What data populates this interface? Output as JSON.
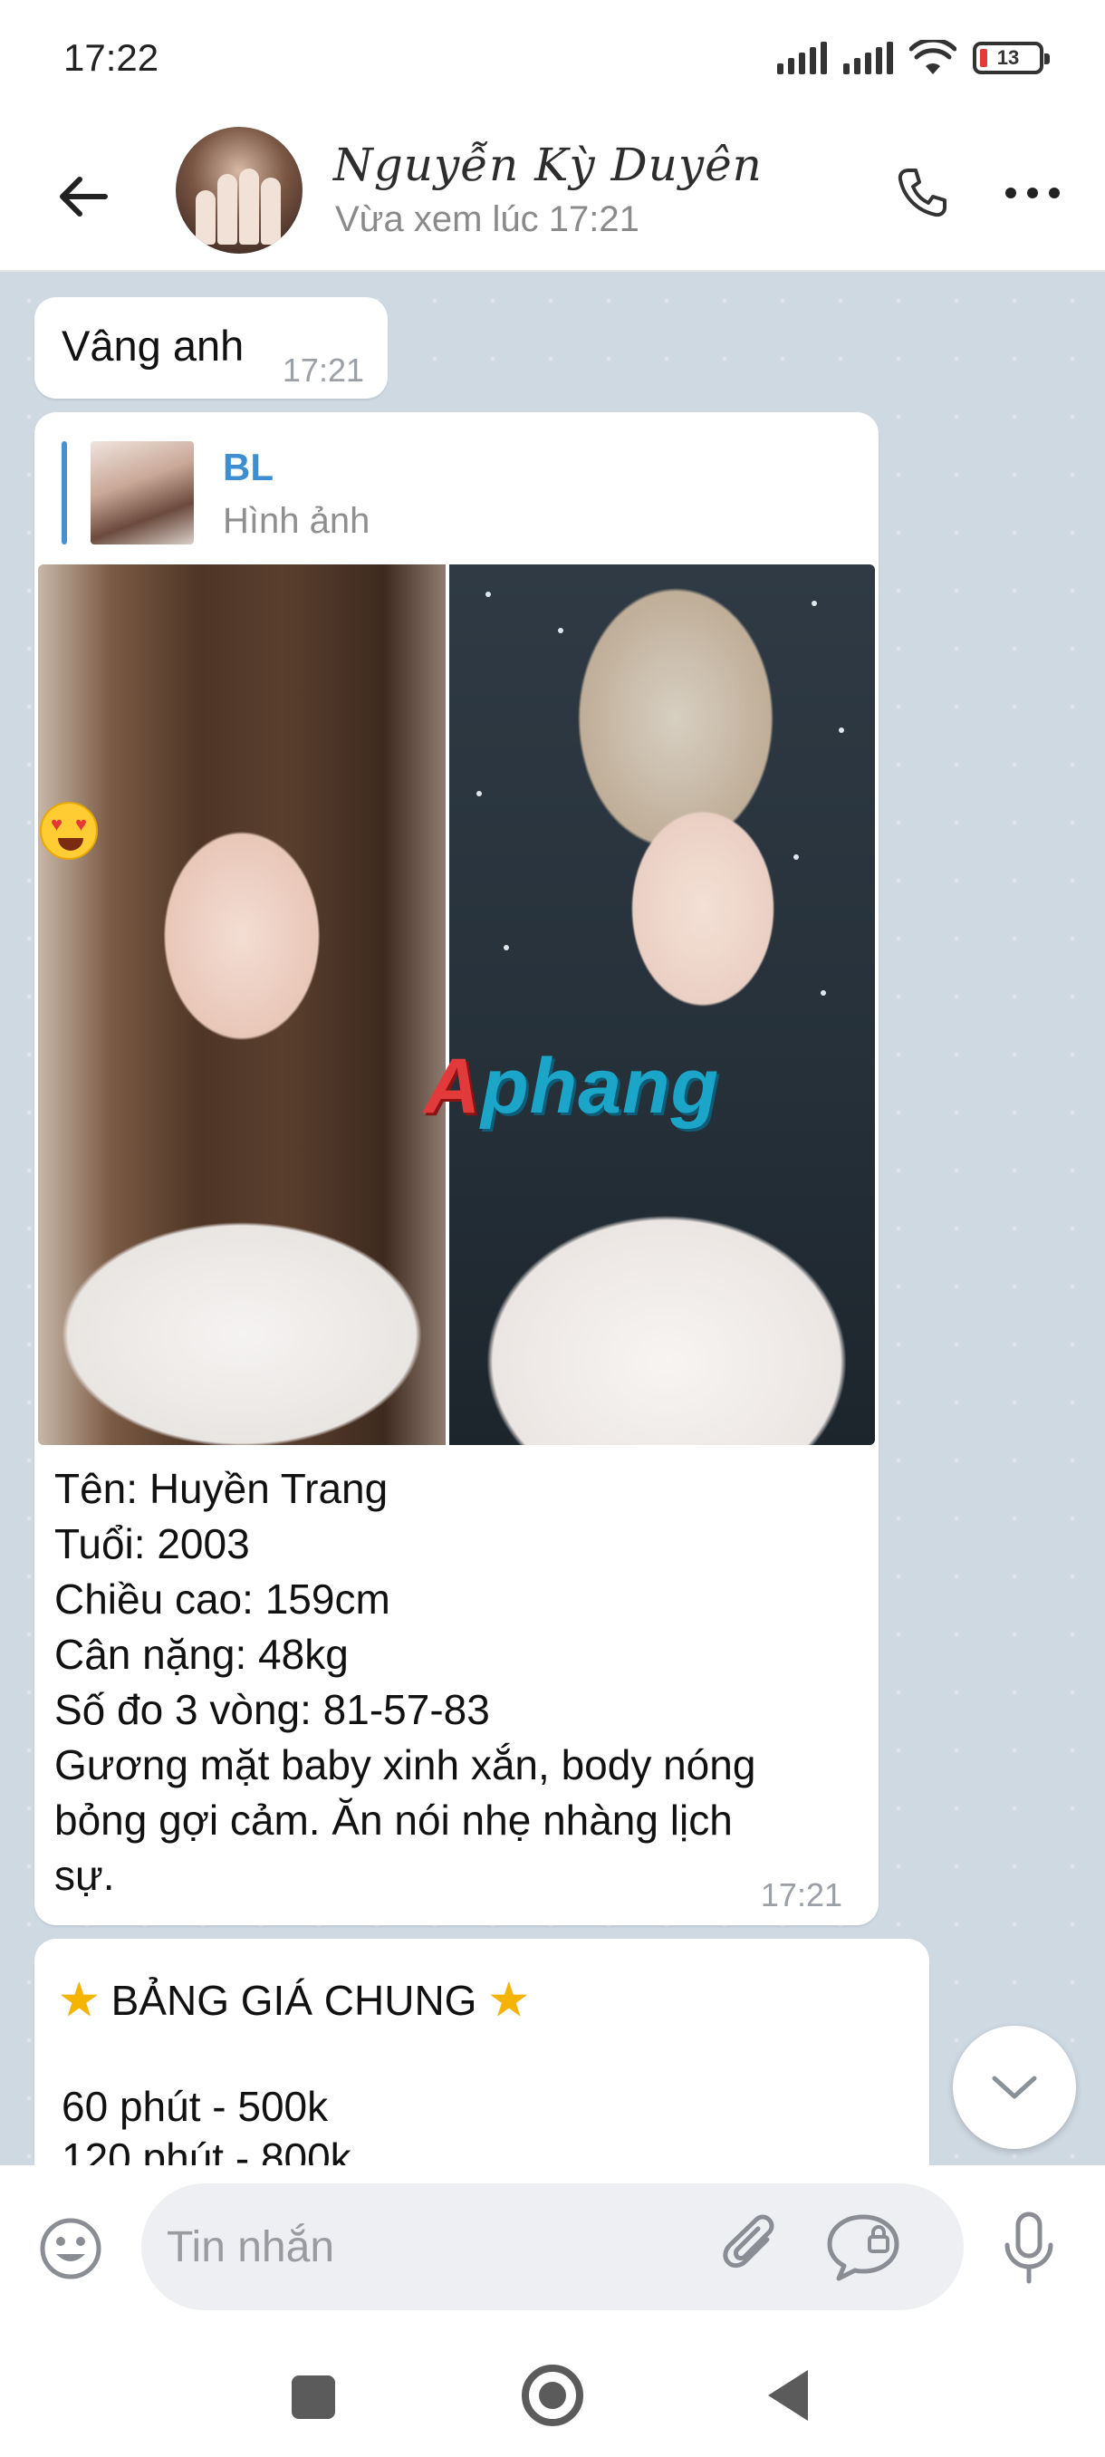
{
  "status_bar": {
    "time": "17:22",
    "battery_level": "13",
    "icons": [
      "signal-icon",
      "signal-icon",
      "wifi-icon",
      "battery-icon"
    ]
  },
  "header": {
    "contact_name": "Nguyễn Kỳ Duyên",
    "last_seen": "Vừa xem lúc 17:21",
    "icons": [
      "back-arrow-icon",
      "phone-icon",
      "more-icon"
    ]
  },
  "messages": [
    {
      "text": "Vâng anh",
      "time": "17:21"
    },
    {
      "reply": {
        "sender": "BL",
        "type": "Hình ảnh"
      },
      "watermark": "Aphang",
      "lines": [
        "Tên: Huyền Trang",
        "Tuổi: 2003",
        "Chiều cao: 159cm",
        "Cân nặng: 48kg",
        "Số đo 3 vòng: 81-57-83",
        "Gương mặt baby xinh xắn, body nóng",
        "bỏng gợi cảm. Ăn nói nhẹ nhàng lịch",
        "sự."
      ],
      "time": "17:21"
    },
    {
      "title": "BẢNG GIÁ CHUNG",
      "lines": [
        "60 phút - 500k",
        "120 phút - 800k"
      ]
    }
  ],
  "input": {
    "placeholder": "Tin nhắn",
    "icons": [
      "emoji-icon",
      "attach-icon",
      "secret-chat-icon",
      "mic-icon"
    ]
  },
  "colors": {
    "accent": "#3d8fd1",
    "chat_background": "#cfd9e2",
    "time_text": "#9aa0a6"
  }
}
